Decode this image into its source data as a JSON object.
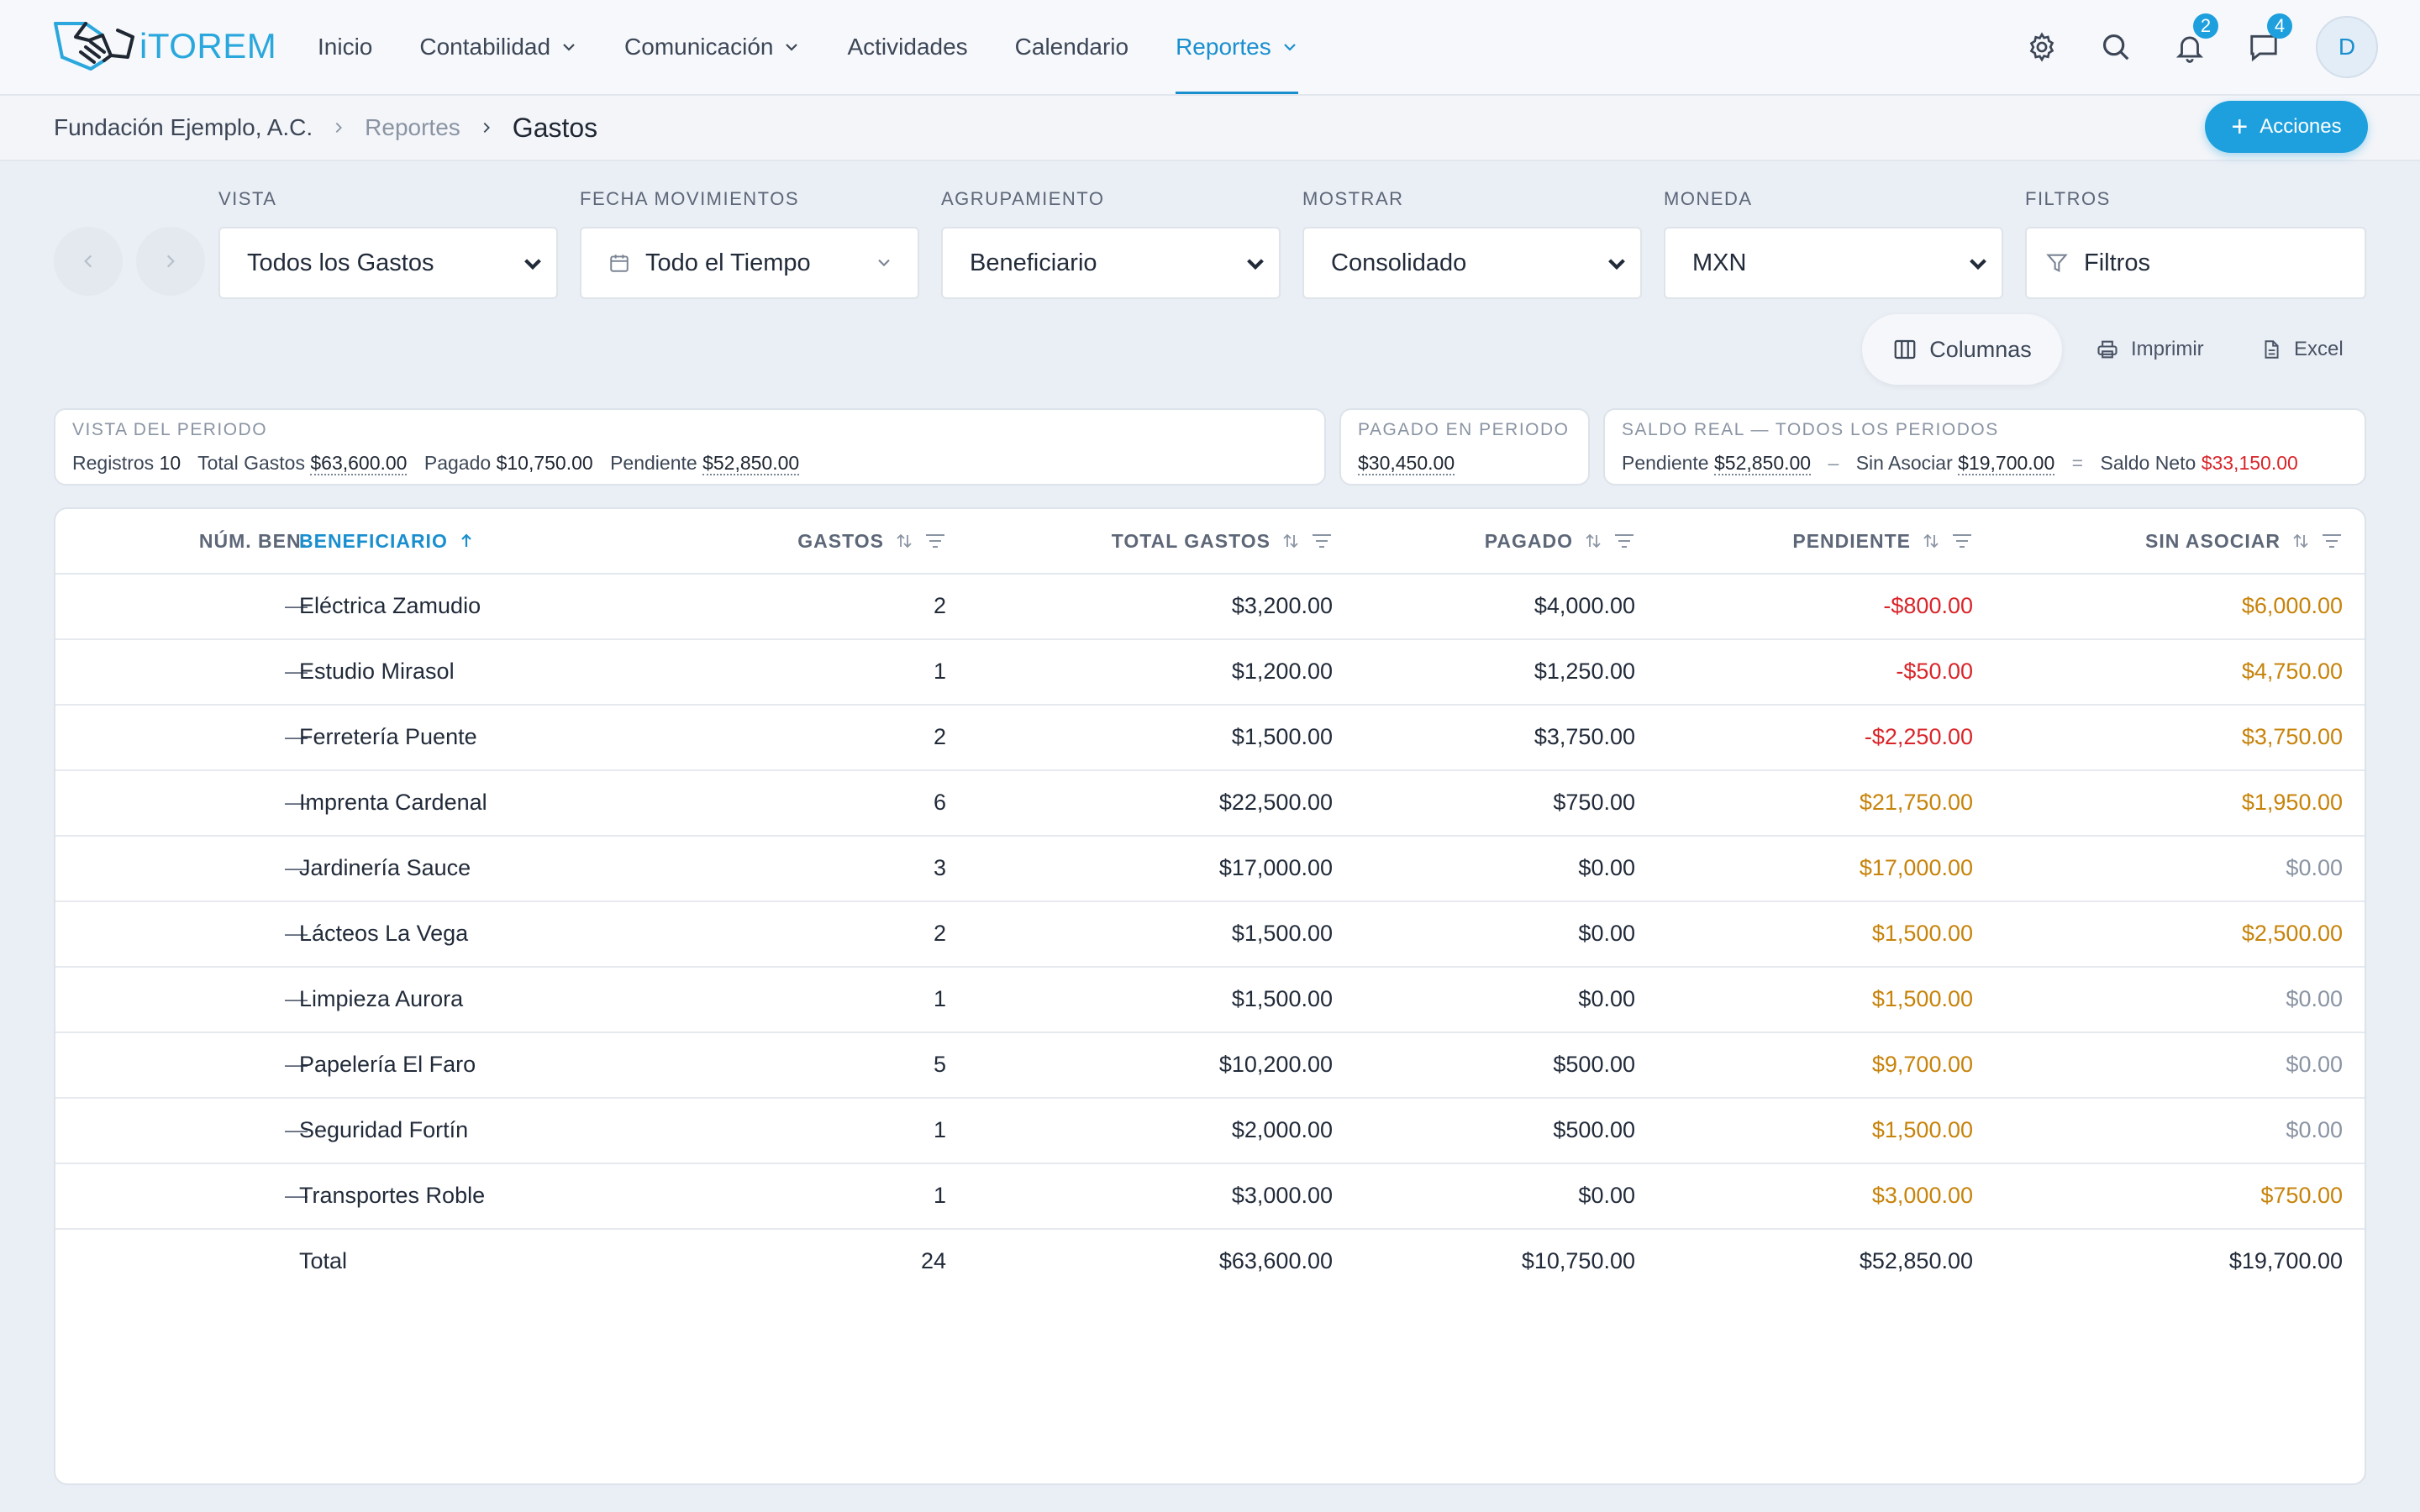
{
  "app": {
    "logo_text": "iTOREM"
  },
  "nav": {
    "items": [
      {
        "label": "Inicio",
        "has_chevron": false,
        "active": false
      },
      {
        "label": "Contabilidad",
        "has_chevron": true,
        "active": false
      },
      {
        "label": "Comunicación",
        "has_chevron": true,
        "active": false
      },
      {
        "label": "Actividades",
        "has_chevron": false,
        "active": false
      },
      {
        "label": "Calendario",
        "has_chevron": false,
        "active": false
      },
      {
        "label": "Reportes",
        "has_chevron": true,
        "active": true
      }
    ],
    "notifications_count": "2",
    "messages_count": "4",
    "avatar_initial": "D"
  },
  "breadcrumb": {
    "org": "Fundación Ejemplo, A.C.",
    "section": "Reportes",
    "page": "Gastos"
  },
  "actions_label": "Acciones",
  "filters": {
    "vista": {
      "label": "VISTA",
      "value": "Todos los Gastos"
    },
    "fecha": {
      "label": "FECHA MOVIMIENTOS",
      "value": "Todo el Tiempo"
    },
    "agrupamiento": {
      "label": "AGRUPAMIENTO",
      "value": "Beneficiario"
    },
    "mostrar": {
      "label": "MOSTRAR",
      "value": "Consolidado"
    },
    "moneda": {
      "label": "MONEDA",
      "value": "MXN"
    },
    "filtros": {
      "label": "FILTROS",
      "value": "Filtros"
    }
  },
  "tools": {
    "columns": "Columnas",
    "print": "Imprimir",
    "excel": "Excel"
  },
  "summary": {
    "periodo": {
      "title": "VISTA DEL PERIODO",
      "registros_label": "Registros",
      "registros": "10",
      "total_label": "Total Gastos",
      "total": "$63,600.00",
      "pagado_label": "Pagado",
      "pagado": "$10,750.00",
      "pendiente_label": "Pendiente",
      "pendiente": "$52,850.00"
    },
    "pagado_periodo": {
      "title": "PAGADO EN PERIODO",
      "value": "$30,450.00"
    },
    "saldo": {
      "title": "SALDO REAL — TODOS LOS PERIODOS",
      "pendiente_label": "Pendiente",
      "pendiente": "$52,850.00",
      "minus": "–",
      "sin_asociar_label": "Sin Asociar",
      "sin_asociar": "$19,700.00",
      "equals": "=",
      "neto_label": "Saldo Neto",
      "neto": "$33,150.00"
    }
  },
  "table": {
    "columns": {
      "num": "NÚM. BEN.",
      "beneficiario": "BENEFICIARIO",
      "gastos": "GASTOS",
      "total": "TOTAL GASTOS",
      "pagado": "PAGADO",
      "pendiente": "PENDIENTE",
      "sin_asociar": "SIN ASOCIAR"
    },
    "rows": [
      {
        "num": "—",
        "beneficiario": "Eléctrica Zamudio",
        "gastos": "2",
        "total": "$3,200.00",
        "pagado": "$4,000.00",
        "pendiente": "-$800.00",
        "pend_state": "neg",
        "sin_asociar": "$6,000.00",
        "sin_state": "amber"
      },
      {
        "num": "—",
        "beneficiario": "Estudio Mirasol",
        "gastos": "1",
        "total": "$1,200.00",
        "pagado": "$1,250.00",
        "pendiente": "-$50.00",
        "pend_state": "neg",
        "sin_asociar": "$4,750.00",
        "sin_state": "amber"
      },
      {
        "num": "—",
        "beneficiario": "Ferretería Puente",
        "gastos": "2",
        "total": "$1,500.00",
        "pagado": "$3,750.00",
        "pendiente": "-$2,250.00",
        "pend_state": "neg",
        "sin_asociar": "$3,750.00",
        "sin_state": "amber"
      },
      {
        "num": "—",
        "beneficiario": "Imprenta Cardenal",
        "gastos": "6",
        "total": "$22,500.00",
        "pagado": "$750.00",
        "pendiente": "$21,750.00",
        "pend_state": "amber",
        "sin_asociar": "$1,950.00",
        "sin_state": "amber"
      },
      {
        "num": "—",
        "beneficiario": "Jardinería Sauce",
        "gastos": "3",
        "total": "$17,000.00",
        "pagado": "$0.00",
        "pendiente": "$17,000.00",
        "pend_state": "amber",
        "sin_asociar": "$0.00",
        "sin_state": "zero"
      },
      {
        "num": "—",
        "beneficiario": "Lácteos La Vega",
        "gastos": "2",
        "total": "$1,500.00",
        "pagado": "$0.00",
        "pendiente": "$1,500.00",
        "pend_state": "amber",
        "sin_asociar": "$2,500.00",
        "sin_state": "amber"
      },
      {
        "num": "—",
        "beneficiario": "Limpieza Aurora",
        "gastos": "1",
        "total": "$1,500.00",
        "pagado": "$0.00",
        "pendiente": "$1,500.00",
        "pend_state": "amber",
        "sin_asociar": "$0.00",
        "sin_state": "zero"
      },
      {
        "num": "—",
        "beneficiario": "Papelería El Faro",
        "gastos": "5",
        "total": "$10,200.00",
        "pagado": "$500.00",
        "pendiente": "$9,700.00",
        "pend_state": "amber",
        "sin_asociar": "$0.00",
        "sin_state": "zero"
      },
      {
        "num": "—",
        "beneficiario": "Seguridad Fortín",
        "gastos": "1",
        "total": "$2,000.00",
        "pagado": "$500.00",
        "pendiente": "$1,500.00",
        "pend_state": "amber",
        "sin_asociar": "$0.00",
        "sin_state": "zero"
      },
      {
        "num": "—",
        "beneficiario": "Transportes Roble",
        "gastos": "1",
        "total": "$3,000.00",
        "pagado": "$0.00",
        "pendiente": "$3,000.00",
        "pend_state": "amber",
        "sin_asociar": "$750.00",
        "sin_state": "amber"
      }
    ],
    "totals": {
      "label": "Total",
      "gastos": "24",
      "total": "$63,600.00",
      "pagado": "$10,750.00",
      "pendiente": "$52,850.00",
      "sin_asociar": "$19,700.00"
    }
  },
  "colors": {
    "accent": "#1da0dd",
    "negative": "#d9252a",
    "pending": "#c7830a",
    "muted": "#8a94a3"
  }
}
